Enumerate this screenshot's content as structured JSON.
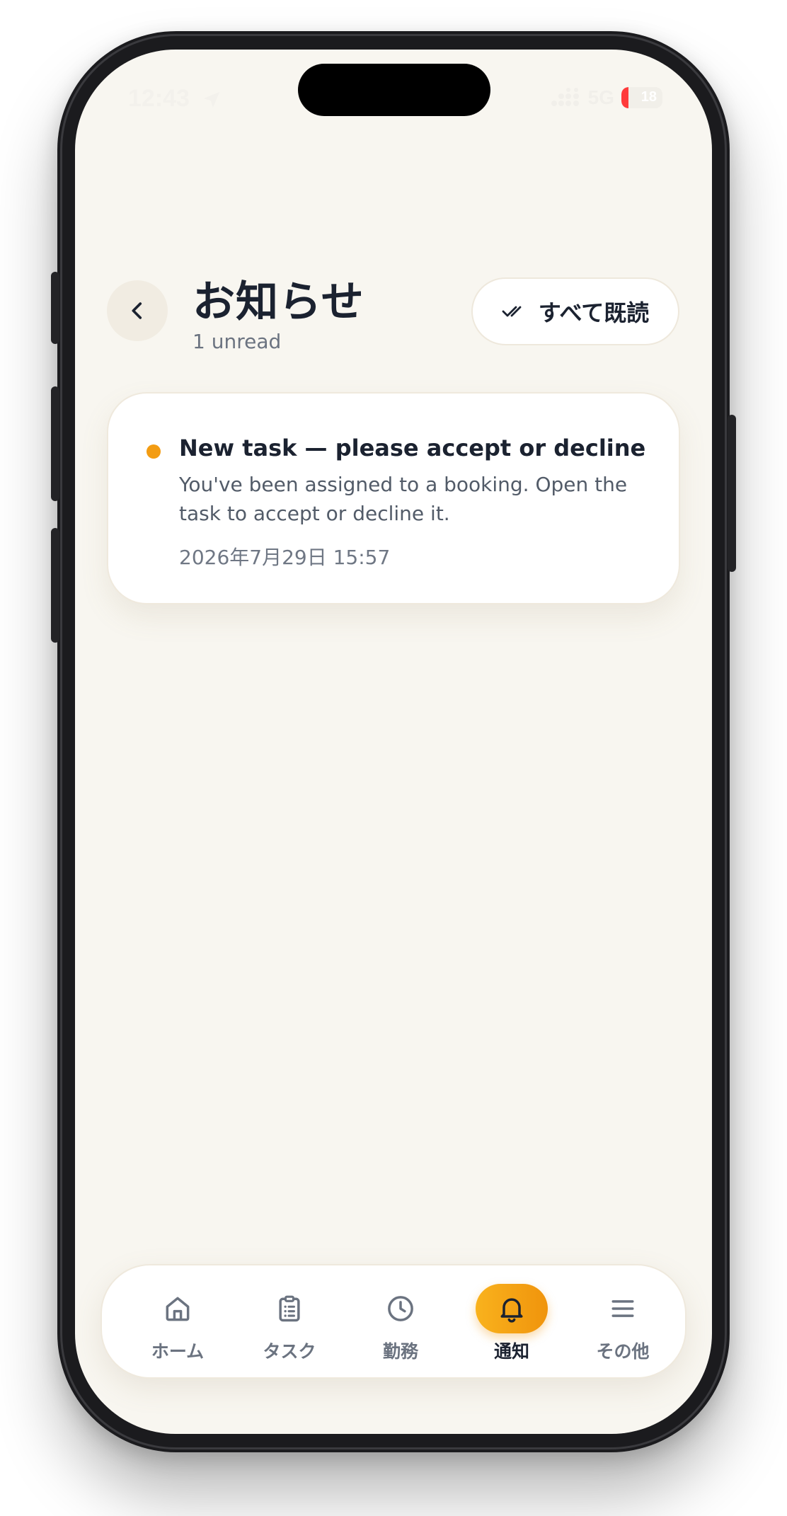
{
  "status_bar": {
    "time": "12:43",
    "network": "5G",
    "battery": "18",
    "battery_level": 0.18
  },
  "header": {
    "title": "お知らせ",
    "subtitle": "1 unread",
    "mark_all_label": "すべて既読"
  },
  "notifications": [
    {
      "title": "New task — please accept or decline",
      "body": "You've been assigned to a booking. Open the task to accept or decline it.",
      "time": "2026年7月29日 15:57",
      "unread": true
    }
  ],
  "tabs": [
    {
      "label": "ホーム",
      "icon": "home-icon",
      "active": false
    },
    {
      "label": "タスク",
      "icon": "clipboard-icon",
      "active": false
    },
    {
      "label": "勤務",
      "icon": "clock-icon",
      "active": false
    },
    {
      "label": "通知",
      "icon": "bell-icon",
      "active": true
    },
    {
      "label": "その他",
      "icon": "menu-icon",
      "active": false
    }
  ],
  "colors": {
    "accent": "#f39c12",
    "background": "#f8f6f0",
    "text": "#1b2230",
    "muted": "#6b7380"
  }
}
